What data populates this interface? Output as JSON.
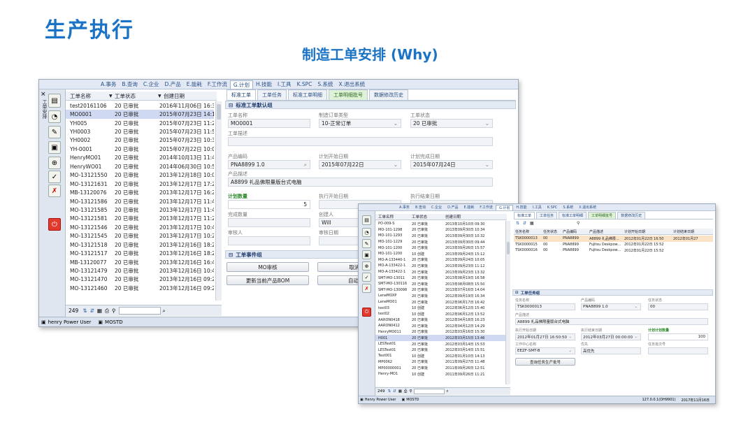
{
  "slide": {
    "title": "生产执行",
    "subtitle": "制造工单安排 (Why)"
  },
  "window1": {
    "menu": [
      "A.事务",
      "B.查询",
      "C.企业",
      "D.产品",
      "E.能耗",
      "F.工作流",
      "G.计划",
      "H.技能",
      "I.工具",
      "K.SPC",
      "S.系统",
      "X.退出系统"
    ],
    "active_menu": 6,
    "sidebar_label": "工单安排",
    "list_headers": [
      "工单名称",
      "工单状态",
      "创建日期"
    ],
    "rows": [
      [
        "test20161106",
        "20 已审批",
        "2016年11月06日 16:3"
      ],
      [
        "MO0001",
        "20 已审批",
        "2015年07月23日 14:1"
      ],
      [
        "YH005",
        "20 已审批",
        "2015年07月23日 11:2"
      ],
      [
        "YH0003",
        "20 已审批",
        "2015年07月23日 11:5"
      ],
      [
        "YH0002",
        "20 已审批",
        "2015年07月23日 10:3"
      ],
      [
        "YH-0001",
        "20 已审批",
        "2015年07月22日 10:0"
      ],
      [
        "HenryMO01",
        "20 已审批",
        "2014年10月13日 11:4"
      ],
      [
        "HenryWO01",
        "20 已审批",
        "2014年06月30日 10:5"
      ],
      [
        "MO-13121550",
        "20 已审批",
        "2013年12月18日 10:0"
      ],
      [
        "MO-13121631",
        "20 已审批",
        "2013年12月17日 17:2"
      ],
      [
        "MB-13120076",
        "20 已审批",
        "2013年12月17日 16:2"
      ],
      [
        "MO-13121586",
        "20 已审批",
        "2013年12月17日 11:4"
      ],
      [
        "MO-13121585",
        "20 已审批",
        "2013年12月17日 11:4"
      ],
      [
        "MO-13121581",
        "20 已审批",
        "2013年12月17日 11:2"
      ],
      [
        "MO-13121546",
        "20 已审批",
        "2013年12月17日 10:4"
      ],
      [
        "MO-13121545",
        "20 已审批",
        "2013年12月17日 10:2"
      ],
      [
        "MO-13121518",
        "20 已审批",
        "2013年12月16日 18:2"
      ],
      [
        "MO-13121517",
        "20 已审批",
        "2013年12月16日 18:2"
      ],
      [
        "MB-13120077",
        "20 已审批",
        "2013年12月16日 16:4"
      ],
      [
        "MO-13121479",
        "20 已审批",
        "2013年12月16日 10:4"
      ],
      [
        "MO-13121470",
        "20 已审批",
        "2013年12月16日 09:2"
      ],
      [
        "MO-13121460",
        "20 已审批",
        "2013年12月16日 09:2"
      ]
    ],
    "selected_row": 1,
    "record_count": "249",
    "status_user": "henry Power User",
    "status_db": "MOSTD",
    "tabs": [
      "标准工单",
      "工单任务",
      "标准工单明细",
      "工单明细批号",
      "数据修改历史"
    ],
    "section_title": "标准工单默认组",
    "form": {
      "mo_name_label": "工单名称",
      "mo_name": "MO0001",
      "order_type_label": "制造订单类型",
      "order_type": "10-正常订单",
      "status_label": "工单状态",
      "status": "20 已审批",
      "desc_label": "工单描述",
      "product_label": "产品编码",
      "product": "PNA8899 1.0",
      "plan_start_label": "计划开始日期",
      "plan_start": "2015年07月22日",
      "plan_end_label": "计划完成日期",
      "plan_end": "2015年07月24日",
      "product_desc_label": "产品描述",
      "product_desc": "A8899 礼品佛限量版台式电脑",
      "plan_qty_label": "计划数量",
      "plan_qty": "5",
      "exec_start_label": "执行开始日期",
      "exec_end_label": "执行结束日期",
      "done_qty_label": "完成数量",
      "creator_label": "创建人",
      "creator": "Will",
      "auditor_label": "审核人",
      "audit_date_label": "审核日期"
    },
    "event_section_title": "工单事件组",
    "buttons": [
      "MO审核",
      "取消MO",
      "更新当前产品BOM",
      "自动生成"
    ]
  },
  "window2": {
    "menu": [
      "A.事务",
      "B.查询",
      "C.企业",
      "D.产品",
      "E.能耗",
      "F.工作流",
      "G.计划",
      "H.技能",
      "I.工具",
      "K.SPC",
      "S.系统",
      "X.退出系统"
    ],
    "active_menu": 6,
    "list_headers": [
      "工单名称",
      "工单状态",
      "创建日期"
    ],
    "rows": [
      [
        "PO-009-S",
        "20 已审批",
        "2013年10月10日 09:30"
      ],
      [
        "MO-101-1298",
        "20 已审批",
        "2013年09月30日 10:34"
      ],
      [
        "MO-101-1293",
        "20 已审批",
        "2013年09月30日 10:32"
      ],
      [
        "MO-101-1229",
        "20 已审批",
        "2013年09月30日 09:44"
      ],
      [
        "MO-101-1200",
        "20 已审批",
        "2013年09月26日 15:57"
      ],
      [
        "MO-101-1200",
        "10 创建",
        "2013年09月24日 15:12"
      ],
      [
        "MO-A-133440-1",
        "20 已审批",
        "2013年09月24日 10:05"
      ],
      [
        "MO-A-133422-1",
        "20 已审批",
        "2013年09月23日 11:12"
      ],
      [
        "MO-A-133422-1",
        "20 已审批",
        "2013年09月23日 13:32"
      ],
      [
        "SMT-MO-13011",
        "20 已审批",
        "2013年08月19日 16:58"
      ],
      [
        "SMT-MO-130116",
        "20 已审批",
        "2013年08月08日 15:50"
      ],
      [
        "SMT-MO-130098",
        "20 已审批",
        "2013年07月16日 14:04"
      ],
      [
        "LeneMOXP",
        "20 已审批",
        "2012年09月19日 16:34"
      ],
      [
        "LeneMO01",
        "20 已审批",
        "2012年06月17日 16:42"
      ],
      [
        "test03",
        "10 创建",
        "2012年06月12日 15:40"
      ],
      [
        "test02",
        "10 创建",
        "2012年06月12日 13:52"
      ],
      [
        "AARON0418",
        "20 已审批",
        "2012年04月18日 16:23"
      ],
      [
        "AARON0412",
        "20 已审批",
        "2012年04月12日 14:29"
      ],
      [
        "HenryMO011",
        "20 已审批",
        "2012年03月16日 15:30"
      ],
      [
        "H001",
        "20 已审批",
        "2012年03月15日 13:46"
      ],
      [
        "LESTest01",
        "20 已审批",
        "2012年03月14日 15:53"
      ],
      [
        "LESTest01",
        "20 已审批",
        "2012年03月14日 15:51"
      ],
      [
        "Test001",
        "10 创建",
        "2012年01月10日 14:13"
      ],
      [
        "MP0062",
        "20 已审批",
        "2011年09月27日 11:48"
      ],
      [
        "MP00000001",
        "20 已审批",
        "2011年09月26日 12:51"
      ],
      [
        "Henry-MO1",
        "10 创建",
        "2011年09月26日 11:21"
      ]
    ],
    "selected_row": 19,
    "record_count": "249",
    "status_user": "Henry Power User",
    "status_db": "MOSTD",
    "status_right": [
      "127.0.0.1(DH9901)",
      "2017年11月16日"
    ],
    "tabs": [
      "标准工单",
      "工单任务",
      "标准工单明细",
      "工单明细批号",
      "数据修改历史"
    ],
    "task_headers": [
      "任务名称",
      "任务状态",
      "产品编码",
      "产品描述",
      "计划开始日期",
      "计划结束日期"
    ],
    "task_rows": [
      [
        "TSK0000013",
        "00",
        "PNA8899",
        "A8899 礼品佛限…",
        "2012年01月22日 16:50",
        "2012年01月27"
      ],
      [
        "TSK0000015",
        "00",
        "PNA8899",
        "Fujitsu Deskpow…",
        "2012年01月22日 15:52",
        ""
      ],
      [
        "TSK0000016",
        "00",
        "PNA8899",
        "Fujitsu Deskpow…",
        "2012年01月22日 15:52",
        ""
      ]
    ],
    "task_section_title": "工单任务组",
    "task_form": {
      "task_name_label": "任务名称",
      "task_name": "TSK0000013",
      "product_label": "产品编码",
      "product": "PNA8899 1.0",
      "task_status_label": "任务状态",
      "task_status": "00",
      "product_desc_label": "产品描述",
      "product_desc": "A8899 礼品佛限量版台式电脑",
      "exec_start_label": "执行开始日期",
      "exec_start": "2012年01月27日 16:50:50",
      "exec_end_label": "执行结束日期",
      "exec_end": "2012年03月27日 00:00:00",
      "plan_qty_label": "计划计划数量",
      "plan_qty": "100",
      "workcenter_label": "工作中心名称",
      "workcenter": "EEZF-SMT-B",
      "priority_label": "优先",
      "priority": "高优先",
      "task_lot_label": "任务批次号"
    },
    "task_button": "查询任务生产批号"
  }
}
